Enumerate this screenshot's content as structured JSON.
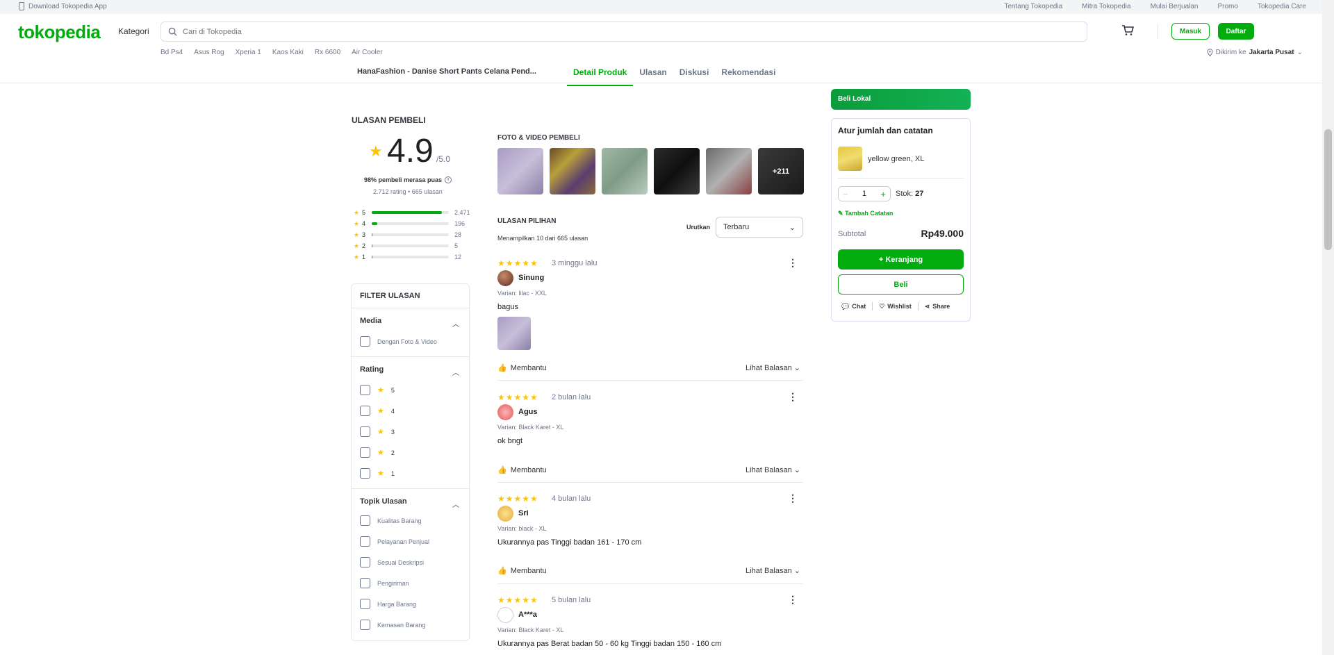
{
  "topstrip": {
    "download": "Download Tokopedia App",
    "links": [
      "Tentang Tokopedia",
      "Mitra Tokopedia",
      "Mulai Berjualan",
      "Promo",
      "Tokopedia Care"
    ]
  },
  "header": {
    "logo": "tokopedia",
    "kategori": "Kategori",
    "search_placeholder": "Cari di Tokopedia",
    "masuk": "Masuk",
    "daftar": "Daftar",
    "keywords": [
      "Bd Ps4",
      "Asus Rog",
      "Xperia 1",
      "Kaos Kaki",
      "Rx 6600",
      "Air Cooler"
    ],
    "deliver_prefix": "Dikirim ke",
    "deliver_location": "Jakarta Pusat"
  },
  "product_nav": {
    "name": "HanaFashion - Danise Short Pants Celana Pend...",
    "tabs": [
      "Detail Produk",
      "Ulasan",
      "Diskusi",
      "Rekomendasi"
    ]
  },
  "rating": {
    "heading": "ULASAN PEMBELI",
    "score": "4.9",
    "out_of": "/5.0",
    "satisfaction": "98% pembeli merasa puas",
    "count_text": "2.712 rating • 665 ulasan",
    "distribution": [
      {
        "star": "5",
        "count": "2.471",
        "fraction": 0.91
      },
      {
        "star": "4",
        "count": "196",
        "fraction": 0.07
      },
      {
        "star": "3",
        "count": "28",
        "fraction": 0.01
      },
      {
        "star": "2",
        "count": "5",
        "fraction": 0.002
      },
      {
        "star": "1",
        "count": "12",
        "fraction": 0.004
      }
    ]
  },
  "filter": {
    "title": "FILTER ULASAN",
    "media_title": "Media",
    "media_option": "Dengan Foto & Video",
    "rating_title": "Rating",
    "rating_options": [
      "5",
      "4",
      "3",
      "2",
      "1"
    ],
    "topik_title": "Topik Ulasan",
    "topik_options": [
      "Kualitas Barang",
      "Pelayanan Penjual",
      "Sesuai Deskripsi",
      "Pengiriman",
      "Harga Barang",
      "Kemasan Barang"
    ]
  },
  "photos": {
    "heading": "FOTO & VIDEO PEMBELI",
    "more": "+211"
  },
  "reviews_header": {
    "heading": "ULASAN PILIHAN",
    "showing": "Menampilkan 10 dari 665 ulasan",
    "sort_label": "Urutkan",
    "sort_value": "Terbaru"
  },
  "reviews": [
    {
      "stars": "★★★★★",
      "time": "3 minggu lalu",
      "name": "Sinung",
      "variant": "Varian: lilac - XXL",
      "text": "bagus",
      "helpful": "Membantu",
      "reply": "Lihat Balasan"
    },
    {
      "stars": "★★★★★",
      "time": "2 bulan lalu",
      "name": "Agus",
      "variant": "Varian: Black Karet - XL",
      "text": "ok bngt",
      "helpful": "Membantu",
      "reply": "Lihat Balasan"
    },
    {
      "stars": "★★★★★",
      "time": "4 bulan lalu",
      "name": "Sri",
      "variant": "Varian: black - XL",
      "text": "Ukurannya pas Tinggi badan 161 - 170 cm",
      "helpful": "Membantu",
      "reply": "Lihat Balasan"
    },
    {
      "stars": "★★★★★",
      "time": "5 bulan lalu",
      "name": "A***a",
      "variant": "Varian: Black Karet - XL",
      "text": "Ukurannya pas Berat badan 50 - 60 kg Tinggi badan 150 - 160 cm"
    }
  ],
  "panel": {
    "beli_lokal": "Beli Lokal",
    "title": "Atur jumlah dan catatan",
    "variant": "yellow green, XL",
    "qty": "1",
    "stock_label": "Stok:",
    "stock_value": "27",
    "note": "Tambah Catatan",
    "subtotal_label": "Subtotal",
    "subtotal_value": "Rp49.000",
    "cart_btn": "+ Keranjang",
    "buy_btn": "Beli",
    "chat": "Chat",
    "wishlist": "Wishlist",
    "share": "Share"
  },
  "colors": {
    "brand": "#03ac0e",
    "star": "#ffc400"
  }
}
